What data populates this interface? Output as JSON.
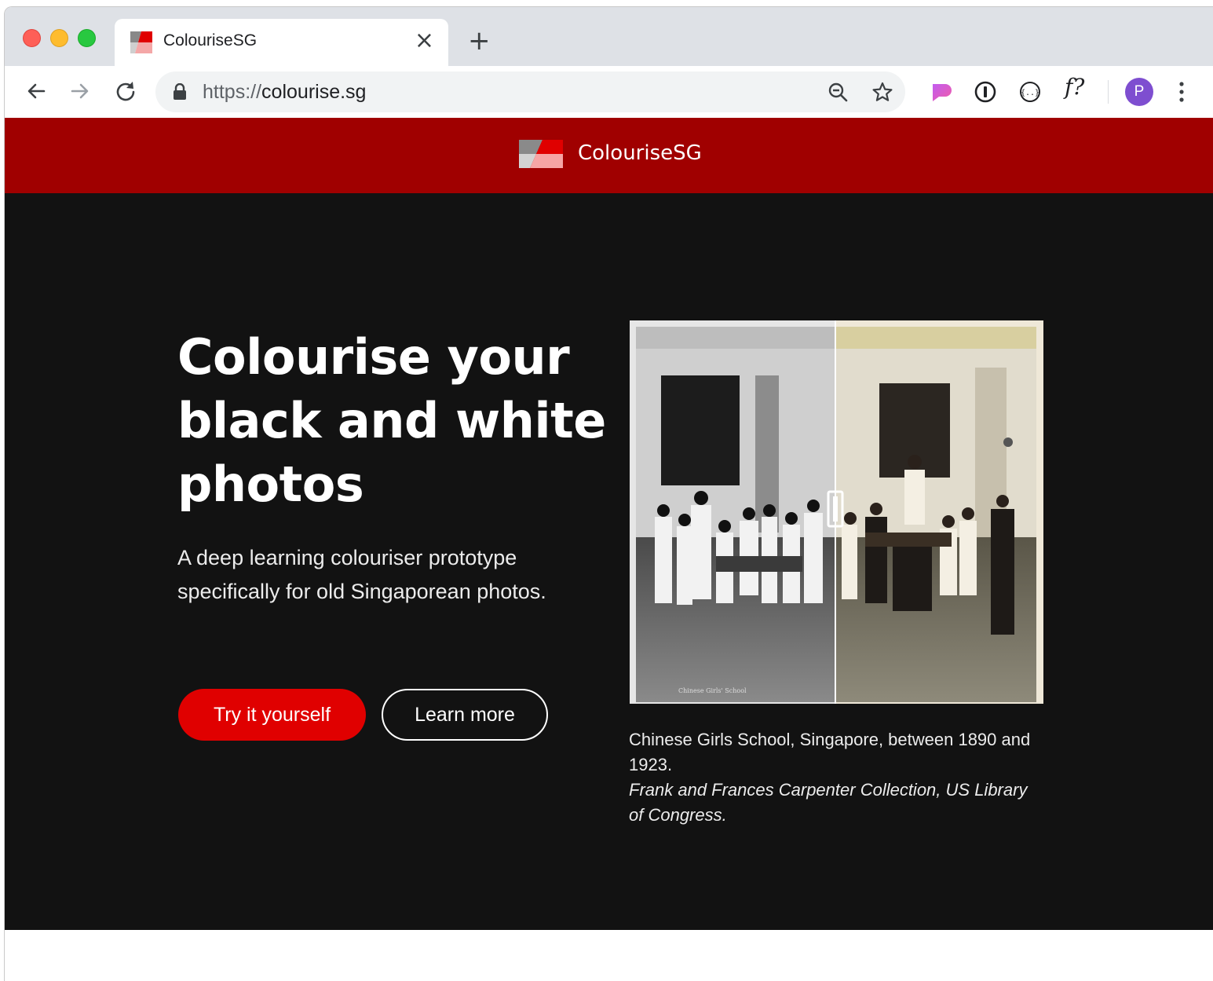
{
  "browser": {
    "tab": {
      "title": "ColouriseSG",
      "close_glyph": "×"
    },
    "new_tab_glyph": "+",
    "address": {
      "scheme": "https://",
      "host": "colourise.sg"
    },
    "extension_f_label": "f?",
    "profile_initial": "P",
    "icons": {
      "back": "arrow-left-icon",
      "forward": "arrow-right-icon",
      "reload": "reload-icon",
      "lock": "lock-icon",
      "zoom": "zoom-out-icon",
      "bookmark": "star-icon",
      "menu": "more-vertical-icon"
    }
  },
  "site": {
    "name": "ColouriseSG",
    "brand_color": "#a00000",
    "accent_color": "#e00000"
  },
  "hero": {
    "title": "Colourise your black and white photos",
    "subtitle": "A deep learning colouriser prototype specifically for old Singaporean photos.",
    "primary_button": "Try it yourself",
    "secondary_button": "Learn more"
  },
  "photo": {
    "stamp": "Chinese Girls' School",
    "caption": "Chinese Girls School, Singapore, between 1890 and 1923.",
    "credit": "Frank and Frances Carpenter Collection, US Library of Congress."
  }
}
